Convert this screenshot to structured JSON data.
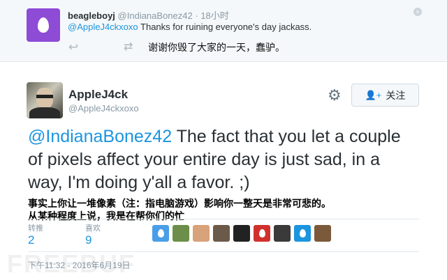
{
  "reply": {
    "name": "beagleboyj",
    "handle": "@IndianaBonez42",
    "sep": "·",
    "time": "18小时",
    "mention": "@AppleJ4ckxoxo",
    "text": " Thanks for ruining everyone's day jackass.",
    "reply_icon": "reply-icon",
    "retweet_icon": "retweet-icon",
    "note": "谢谢你毁了大家的一天，蠢驴。",
    "avatar_color": "#8e4bd6"
  },
  "tweet": {
    "name": "AppleJ4ck",
    "handle": "@AppleJ4ckxoxo",
    "follow_label": "关注",
    "mention": "@IndianaBonez42",
    "text": " The fact that you let a couple of pixels affect your entire day is just sad, in a way, I'm doing y'all a favor. ;)",
    "translation_line1": "事实上你让一堆像素（注：指电脑游戏）影响你一整天是非常可悲的。",
    "translation_line2": "从某种程度上说，我是在帮你们的忙",
    "stats": [
      {
        "label": "转推",
        "value": "2"
      },
      {
        "label": "喜欢",
        "value": "9"
      }
    ],
    "timestamp": "下午11:32 - 2016年6月19日",
    "likers": [
      {
        "icon": "egg-avatar",
        "color": "#4a9ee8"
      },
      {
        "icon": "user-avatar",
        "color": "#6b8f4a"
      },
      {
        "icon": "user-avatar",
        "color": "#d8a27a"
      },
      {
        "icon": "user-avatar",
        "color": "#6b5a4a"
      },
      {
        "icon": "user-avatar",
        "color": "#222222"
      },
      {
        "icon": "egg-avatar",
        "color": "#d0312d"
      },
      {
        "icon": "user-avatar",
        "color": "#3a3a3a"
      },
      {
        "icon": "egg-avatar",
        "color": "#1b95e0"
      },
      {
        "icon": "user-avatar",
        "color": "#7a5a3a"
      }
    ]
  },
  "watermark": "FREEBUF"
}
